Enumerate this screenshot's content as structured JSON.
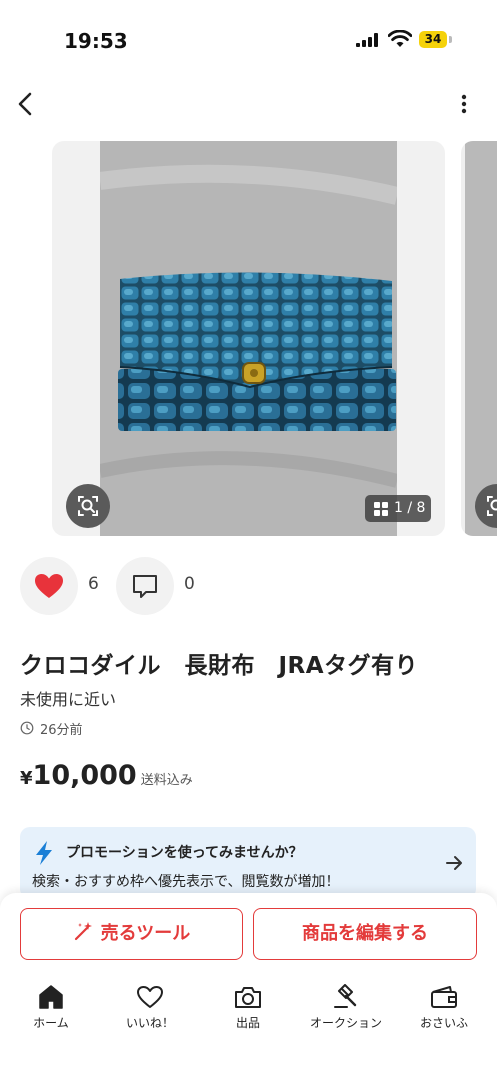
{
  "status_bar": {
    "time": "19:53",
    "battery": "34"
  },
  "product": {
    "image_counter": "1 / 8",
    "like_count": "6",
    "comment_count": "0",
    "title": "クロコダイル　長財布　JRAタグ有り",
    "condition": "未使用に近い",
    "posted_time": "26分前",
    "price_currency": "¥",
    "price": "10,000",
    "shipping": "送料込み"
  },
  "promotion": {
    "headline": "プロモーションを使ってみませんか？",
    "description": "検索・おすすめ枠へ優先表示で、閲覧数が増加！"
  },
  "actions": {
    "sell_tools": "売るツール",
    "edit_item": "商品を編集する"
  },
  "tab_bar": [
    {
      "label": "ホーム",
      "icon": "home-icon"
    },
    {
      "label": "いいね！",
      "icon": "heart-outline-icon"
    },
    {
      "label": "出品",
      "icon": "camera-icon"
    },
    {
      "label": "オークション",
      "icon": "gavel-icon"
    },
    {
      "label": "おさいふ",
      "icon": "wallet-icon"
    }
  ],
  "colors": {
    "accent_red": "#e33b3b",
    "heart_red": "#e8333b",
    "promo_bg": "#e6f1fb",
    "bolt_blue": "#1a7fd6",
    "battery_yellow": "#f5d20a"
  }
}
